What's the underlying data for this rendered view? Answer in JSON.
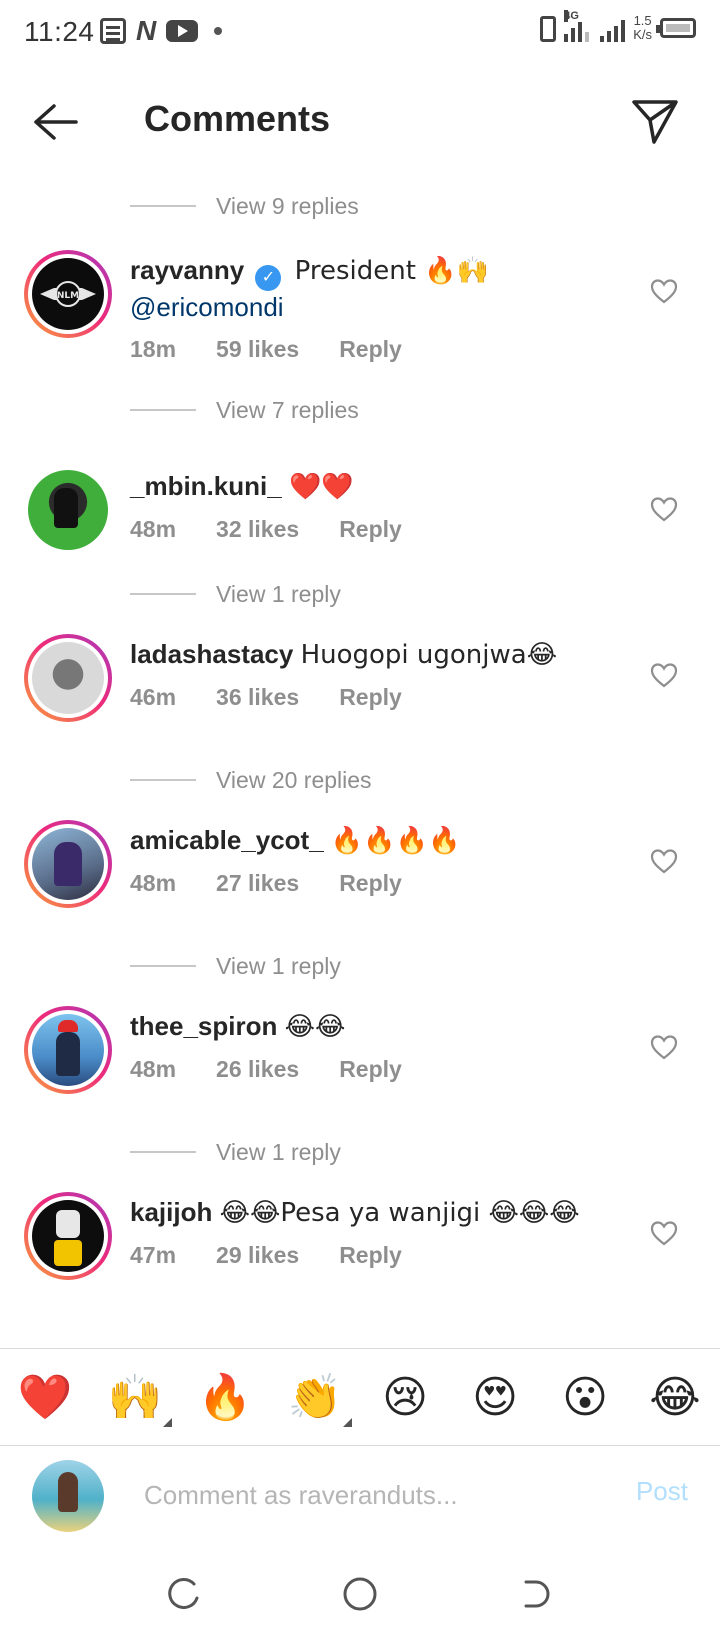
{
  "status_bar": {
    "time": "11:24",
    "network": "4G",
    "speed_value": "1.5",
    "speed_unit": "K/s"
  },
  "header": {
    "title": "Comments",
    "back_icon": "arrow-left-icon",
    "share_icon": "send-icon"
  },
  "view_replies": [
    "View 9 replies",
    "View 7 replies",
    "View 1 reply",
    "View 20 replies",
    "View 1 reply",
    "View 1 reply"
  ],
  "comments": [
    {
      "username": "rayvanny",
      "verified": true,
      "text": "President 🔥🙌",
      "mention": "@ericomondi",
      "time": "18m",
      "likes": "59 likes",
      "reply": "Reply",
      "avatar_label": "NLM"
    },
    {
      "username": "_mbin.kuni_",
      "text": "❤️❤️",
      "time": "48m",
      "likes": "32 likes",
      "reply": "Reply"
    },
    {
      "username": "ladashastacy",
      "text": "Huogopi ugonjwa😂",
      "time": "46m",
      "likes": "36 likes",
      "reply": "Reply"
    },
    {
      "username": "amicable_ycot_",
      "text": "🔥🔥🔥🔥",
      "time": "48m",
      "likes": "27 likes",
      "reply": "Reply"
    },
    {
      "username": "thee_spiron",
      "text": "😂😂",
      "time": "48m",
      "likes": "26 likes",
      "reply": "Reply"
    },
    {
      "username": "kajijoh",
      "text": "😂😂Pesa ya wanjigi 😂😂😂",
      "time": "47m",
      "likes": "29 likes",
      "reply": "Reply"
    }
  ],
  "emoji_bar": [
    "❤️",
    "🙌",
    "🔥",
    "👏",
    "😢",
    "😍",
    "😮",
    "😂"
  ],
  "compose": {
    "placeholder": "Comment as raveranduts...",
    "post_label": "Post"
  },
  "colors": {
    "accent": "#3897f0",
    "mention": "#00376b",
    "meta": "#8e8e8e",
    "post_disabled": "#b2dffc"
  }
}
